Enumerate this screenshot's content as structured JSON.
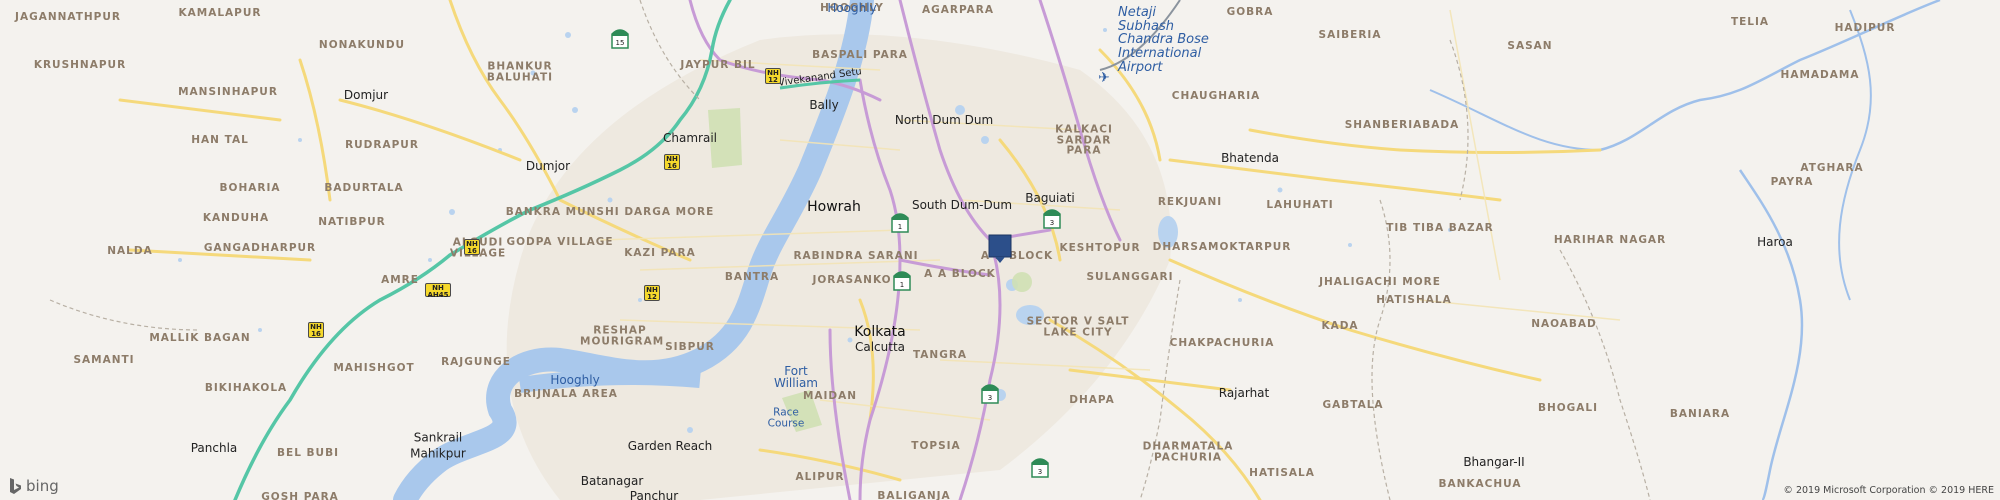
{
  "map": {
    "provider": "bing",
    "copyright": "© 2019 Microsoft Corporation © 2019 HERE",
    "colors": {
      "land": "#f4f2ee",
      "water": "#a9c8ec",
      "major_road": "#c79bd6",
      "national_highway": "#55c6a6",
      "road": "#f5d97b",
      "label_area": "#8d7c69",
      "pin": "#2c4f8a"
    },
    "area_labels": [
      "JAGANNATHPUR",
      "KAMALAPUR",
      "NONAKUNDU",
      "KRUSHNAPUR",
      "MANSINHAPUR",
      "HAN TAL",
      "RUDRAPUR",
      "BOHARIA",
      "BADURTALA",
      "KANDUHA",
      "NATIBPUR",
      "NALDA",
      "GANGADHARPUR",
      "MALLIK BAGAN",
      "SAMANTI",
      "BIKIHAKOLA",
      "BEL BUBI",
      "GOSH PARA",
      "BHANKUR BALUHATI",
      "JAYPUR BIL",
      "BASPALI PARA",
      "AGARPARA",
      "HOOGHLY",
      "BANKRA MUNSHI DARGA MORE",
      "GODPA VILLAGE",
      "KAZI PARA",
      "BANTRA",
      "RABINDRA SARANI",
      "JORASANKO",
      "ALGUDI VILLAGE",
      "AMRE",
      "MAHISHGOT",
      "RAJGUNGE",
      "RESHAP MOURIGRAM",
      "SIBPUR",
      "BRIJNALA AREA",
      "MAIDAN",
      "TANGRA",
      "TOPSIA",
      "ALIPUR",
      "BALIGANJA",
      "A A BLOCK",
      "A D BLOCK",
      "KESHTOPUR",
      "KALKACI SARDAR PARA",
      "SULANGGARI",
      "SECTOR V SALT LAKE CITY",
      "DHAPA",
      "DHARMATALA PACHURIA",
      "HATISALA",
      "CHAKPACHURIA",
      "GABTALA",
      "KADA",
      "HATISHALA",
      "NAOABAD",
      "BHOGALI",
      "BANIARA",
      "BANKACHUA",
      "REKJUANI",
      "LAHUHATI",
      "DHARSAMOKTARPUR",
      "JHALIGACHI MORE",
      "TIB TIBA BAZAR",
      "HARIHAR NAGAR",
      "CHAUGHARIA",
      "SHANBERIABADA",
      "GOBRA",
      "SAIBERIA",
      "SASAN",
      "TELIA",
      "HADIPUR",
      "HAMADAMA",
      "ATGHARA",
      "PAYRA"
    ],
    "place_labels": [
      "Domjur",
      "Dumjor",
      "Chamrail",
      "Bally",
      "North Dum Dum",
      "South Dum-Dum",
      "Baguiati",
      "Bhatenda",
      "Haroa",
      "Rajarhat",
      "Bhangar-II",
      "Garden Reach",
      "Batanagar",
      "Panchla",
      "Sankrail Mahikpur",
      "Panchur",
      "Race Course"
    ],
    "major_labels": [
      "Howrah",
      "Kolkata",
      "Calcutta"
    ],
    "water_labels": [
      "Hooghly",
      "Hooghly",
      "Fort William"
    ],
    "airport_label": "Netaji\nSubhash\nChandra Bose\nInternational\nAirport",
    "bridge_label": "Vivekanand Setu",
    "route_shields": [
      {
        "type": "sh",
        "number": "15"
      },
      {
        "type": "nh",
        "prefix": "NH",
        "number": "12"
      },
      {
        "type": "nh",
        "prefix": "NH",
        "number": "16"
      },
      {
        "type": "nh",
        "prefix": "NH",
        "number": "16"
      },
      {
        "type": "nh",
        "prefix": "NH",
        "number": "AH45"
      },
      {
        "type": "nh",
        "prefix": "NH",
        "number": "12"
      },
      {
        "type": "nh",
        "prefix": "NH",
        "number": "16"
      },
      {
        "type": "sh",
        "number": "1"
      },
      {
        "type": "sh",
        "number": "1"
      },
      {
        "type": "sh",
        "number": "3"
      },
      {
        "type": "sh",
        "number": "3"
      },
      {
        "type": "sh",
        "number": "3"
      }
    ]
  }
}
